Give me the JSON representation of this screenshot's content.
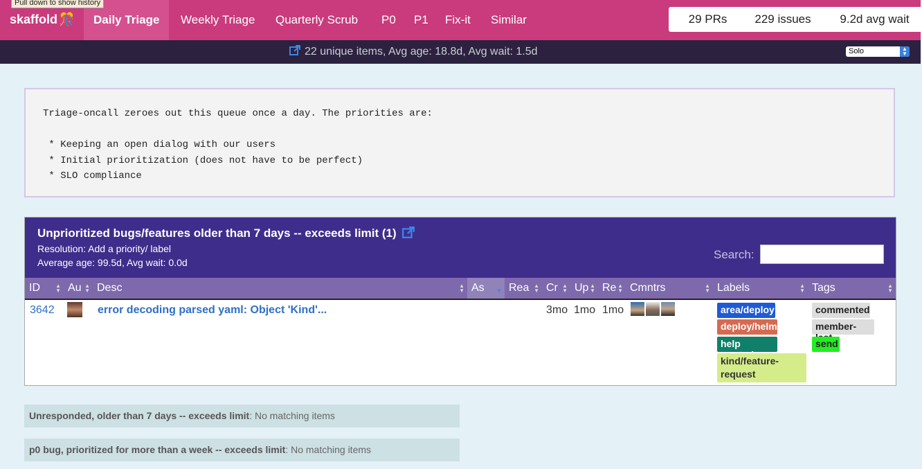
{
  "tooltip": "Pull down to show history",
  "brand": {
    "name": "skaffold",
    "icon": "party-popper"
  },
  "nav": [
    {
      "label": "Daily Triage",
      "active": true
    },
    {
      "label": "Weekly Triage"
    },
    {
      "label": "Quarterly Scrub"
    },
    {
      "label": "P0"
    },
    {
      "label": "P1"
    },
    {
      "label": "Fix-it"
    },
    {
      "label": "Similar"
    }
  ],
  "stats": {
    "prs": "29 PRs",
    "issues": "229 issues",
    "wait": "9.2d avg wait"
  },
  "subbar": {
    "summary": "22 unique items, Avg age: 18.8d, Avg wait: 1.5d",
    "player_select": "Solo"
  },
  "description": "Triage-oncall zeroes out this queue once a day. The priorities are:\n\n * Keeping an open dialog with our users\n * Initial prioritization (does not have to be perfect)\n * SLO compliance",
  "panel": {
    "title": "Unprioritized bugs/features older than 7 days -- exceeds limit (1)",
    "resolution": "Resolution: Add a priority/ label",
    "average": "Average age: 99.5d, Avg wait: 0.0d",
    "search_label": "Search:",
    "columns": [
      "ID",
      "Au",
      "Desc",
      "As",
      "Rea",
      "Cr",
      "Up",
      "Re",
      "Cmntrs",
      "Labels",
      "Tags"
    ],
    "row": {
      "id": "3642",
      "title": "error decoding parsed yaml: Object 'Kind'...",
      "created": "3mo",
      "updated": "1mo",
      "responded": "1mo",
      "labels": [
        {
          "text": "area/deploy",
          "bg": "#1f5ad6",
          "fg": "#ffffff"
        },
        {
          "text": "deploy/helm",
          "bg": "#d56a52",
          "fg": "#ffffff"
        },
        {
          "text": "help wanted",
          "bg": "#11806a",
          "fg": "#ffffff"
        },
        {
          "text": "kind/feature-request",
          "bg": "#d4ec8a",
          "fg": "#333333"
        }
      ],
      "tags": [
        {
          "text": "commented",
          "bg": "#dddddd"
        },
        {
          "text": "member-last",
          "bg": "#dddddd"
        },
        {
          "text": "send",
          "bg": "#22ee22"
        }
      ]
    }
  },
  "empty_rules": [
    {
      "title": "Unresponded, older than 7 days -- exceeds limit",
      "status": ": No matching items"
    },
    {
      "title": "p0 bug, prioritized for more than a week -- exceeds limit",
      "status": ": No matching items"
    }
  ]
}
